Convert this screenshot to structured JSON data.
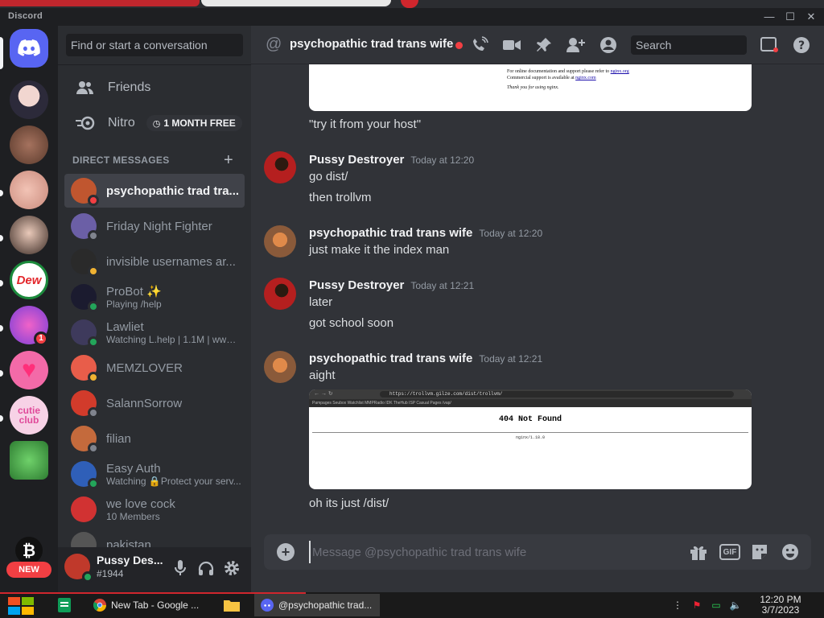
{
  "window": {
    "brand": "Discord",
    "minimize": "—",
    "maximize": "☐",
    "close": "✕"
  },
  "rail": {
    "unread_badge": "1",
    "new_label": "NEW"
  },
  "sidebar": {
    "search_placeholder": "Find or start a conversation",
    "friends_label": "Friends",
    "nitro_label": "Nitro",
    "nitro_badge": "1 MONTH FREE",
    "dm_header": "DIRECT MESSAGES",
    "dms": [
      {
        "name": "psychopathic trad tra...",
        "sub": "",
        "status": "dnd",
        "color": "#c0562f",
        "active": true
      },
      {
        "name": "Friday Night Fighter",
        "sub": "",
        "status": "off",
        "color": "#6b5fa6"
      },
      {
        "name": "invisible usernames ar...",
        "sub": "",
        "status": "idle",
        "color": "#2a2a2a"
      },
      {
        "name": "ProBot ✨",
        "sub": "Playing /help",
        "status": "online",
        "color": "#1b1b2f"
      },
      {
        "name": "Lawliet",
        "sub": "Watching L.help | 1.1M | www.l...",
        "status": "online",
        "color": "#3e3a5c"
      },
      {
        "name": "MEMZLOVER",
        "sub": "",
        "status": "idle",
        "color": "#e85d4a"
      },
      {
        "name": "SalannSorrow",
        "sub": "",
        "status": "off",
        "color": "#d23b2b"
      },
      {
        "name": "filian",
        "sub": "",
        "status": "off",
        "color": "#c46a3c"
      },
      {
        "name": "Easy Auth",
        "sub": "Watching 🔒Protect your serv...",
        "status": "online",
        "color": "#2f5fb8"
      },
      {
        "name": "we love cock",
        "sub": "10 Members",
        "status": "",
        "color": "#d13232"
      },
      {
        "name": "pakistan",
        "sub": "",
        "status": "",
        "color": "#555"
      }
    ]
  },
  "user": {
    "name": "Pussy Des...",
    "tag": "#1944",
    "status": "online"
  },
  "header": {
    "title": "psychopathic trad trans wife",
    "search_placeholder": "Search"
  },
  "embed_top": {
    "line1": "For online documentation and support please refer to",
    "link1": "nginx.org",
    "line2": "Commercial support is available at",
    "link2": "nginx.com",
    "line3": "Thank you for using nginx."
  },
  "messages": [
    {
      "kind": "cont",
      "text": "\"try it from your host\""
    },
    {
      "kind": "group",
      "author": "Pussy Destroyer",
      "time": "Today at 12:20",
      "lines": [
        "go dist/",
        "then trollvm"
      ],
      "color": "#b51f1f"
    },
    {
      "kind": "group",
      "author": "psychopathic trad trans wife",
      "time": "Today at 12:20",
      "lines": [
        "just make it the index man"
      ],
      "color": "#c0562f"
    },
    {
      "kind": "group",
      "author": "Pussy Destroyer",
      "time": "Today at 12:21",
      "lines": [
        "later",
        "got school soon"
      ],
      "color": "#b51f1f"
    },
    {
      "kind": "group",
      "author": "psychopathic trad trans wife",
      "time": "Today at 12:21",
      "lines": [
        "aight"
      ],
      "color": "#c0562f"
    },
    {
      "kind": "cont",
      "text": "oh its just /dist/"
    }
  ],
  "screenshot_embed": {
    "url": "https://trollvm.gilze.com/dist/trollvm/",
    "bookmarks": "Pampages  Seubox  Watchlist  MMPRadio  IDK  TheHub  ISP  Casual Pages  /vap/",
    "heading": "404 Not Found",
    "server": "nginx/1.18.0"
  },
  "composer": {
    "placeholder": "Message @psychopathic trad trans wife",
    "gif_label": "GIF"
  },
  "taskbar": {
    "apps": [
      {
        "label": "New Tab - Google ...",
        "active": false
      },
      {
        "label": "@psychopathic trad...",
        "active": true
      }
    ],
    "time": "12:20 PM",
    "date": "3/7/2023"
  },
  "colors": {
    "accent": "#5865f2",
    "online": "#23a55a",
    "idle": "#f0b232",
    "dnd": "#f23f43",
    "offline": "#80848e"
  }
}
